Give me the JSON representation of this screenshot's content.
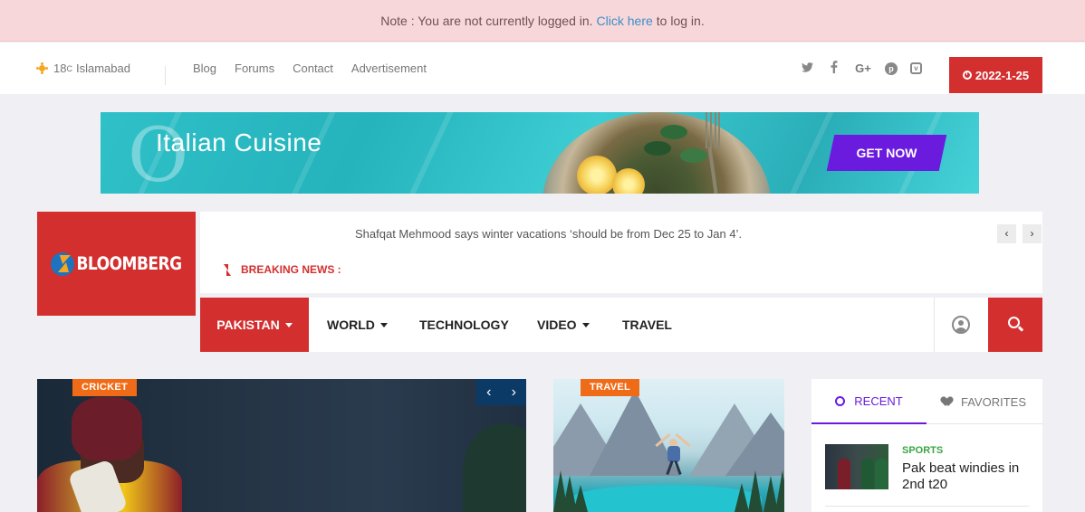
{
  "notice": {
    "prefix": "Note : You are not currently logged in.",
    "link": "Click here",
    "suffix": "to log in."
  },
  "topbar": {
    "weather_temp": "18",
    "weather_unit": "C",
    "weather_city": "Islamabad",
    "nav": [
      "Blog",
      "Forums",
      "Contact",
      "Advertisement"
    ],
    "social_icons": [
      "twitter-icon",
      "facebook-icon",
      "google-plus-icon",
      "pinterest-icon",
      "vimeo-icon"
    ],
    "date": "2022-1-25"
  },
  "banner": {
    "title": "Italian Cuisine",
    "cta": "GET NOW"
  },
  "logo": {
    "text": "BLOOMBERG"
  },
  "breaking": {
    "headline": "Shafqat Mehmood says winter vacations ‘should be from Dec 25 to Jan 4’.",
    "label": "BREAKING NEWS :",
    "prev": "‹",
    "next": "›"
  },
  "mainnav": {
    "items": [
      {
        "label": "PAKISTAN"
      },
      {
        "label": "WORLD"
      },
      {
        "label": "TECHNOLOGY"
      },
      {
        "label": "VIDEO"
      },
      {
        "label": "TRAVEL"
      }
    ]
  },
  "slider": {
    "tag": "CRICKET",
    "prev": "‹",
    "next": "›"
  },
  "travel_card": {
    "tag": "TRAVEL"
  },
  "widget": {
    "tabs": [
      "RECENT",
      "FAVORITES"
    ],
    "post": {
      "category": "SPORTS",
      "title": "Pak beat windies in 2nd t20"
    }
  },
  "colors": {
    "brand_red": "#d32f2f",
    "accent_purple": "#6a1bde",
    "tag_orange": "#f06b17",
    "notice_bg": "#f8d7da",
    "category_green": "#3aa543"
  }
}
